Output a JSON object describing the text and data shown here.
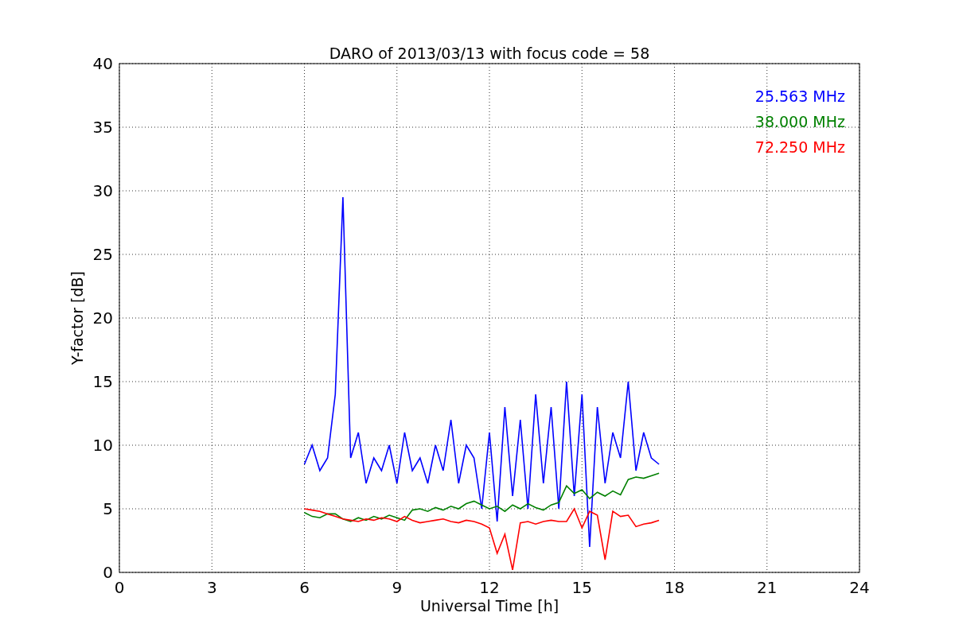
{
  "chart_data": {
    "type": "line",
    "title": "DARO of 2013/03/13 with focus code = 58",
    "xlabel": "Universal Time [h]",
    "ylabel": "Y-factor [dB]",
    "x": [
      6,
      6.25,
      6.5,
      6.75,
      7,
      7.25,
      7.5,
      7.75,
      8,
      8.25,
      8.5,
      8.75,
      9,
      9.25,
      9.5,
      9.75,
      10,
      10.25,
      10.5,
      10.75,
      11,
      11.25,
      11.5,
      11.75,
      12,
      12.25,
      12.5,
      12.75,
      13,
      13.25,
      13.5,
      13.75,
      14,
      14.25,
      14.5,
      14.75,
      15,
      15.25,
      15.5,
      15.75,
      16,
      16.25,
      16.5,
      16.75,
      17,
      17.25,
      17.5
    ],
    "series": [
      {
        "name": "25.563 MHz",
        "color": "#0000ff",
        "values": [
          8.5,
          10,
          8,
          9,
          14,
          29.5,
          9,
          11,
          7,
          9,
          8,
          10,
          7,
          11,
          8,
          9,
          7,
          10,
          8,
          12,
          7,
          10,
          9,
          5,
          11,
          4,
          13,
          6,
          12,
          5,
          14,
          7,
          13,
          5,
          15,
          6,
          14,
          2,
          13,
          7,
          11,
          9,
          15,
          8,
          11,
          9,
          8.5
        ]
      },
      {
        "name": "38.000 MHz",
        "color": "#008000",
        "values": [
          4.7,
          4.4,
          4.3,
          4.6,
          4.6,
          4.2,
          4.0,
          4.3,
          4.1,
          4.4,
          4.2,
          4.5,
          4.3,
          4.1,
          4.9,
          5.0,
          4.8,
          5.1,
          4.9,
          5.2,
          5.0,
          5.4,
          5.6,
          5.3,
          5.0,
          5.2,
          4.8,
          5.3,
          5.0,
          5.4,
          5.1,
          4.9,
          5.3,
          5.5,
          6.8,
          6.2,
          6.5,
          5.8,
          6.3,
          6.0,
          6.4,
          6.1,
          7.3,
          7.5,
          7.4,
          7.6,
          7.8
        ]
      },
      {
        "name": "72.250 MHz",
        "color": "#ff0000",
        "values": [
          5.0,
          4.9,
          4.8,
          4.6,
          4.4,
          4.2,
          4.1,
          4.0,
          4.2,
          4.1,
          4.3,
          4.2,
          4.0,
          4.4,
          4.1,
          3.9,
          4.0,
          4.1,
          4.2,
          4.0,
          3.9,
          4.1,
          4.0,
          3.8,
          3.5,
          1.5,
          3.0,
          0.2,
          3.9,
          4.0,
          3.8,
          4.0,
          4.1,
          4.0,
          4.0,
          5.0,
          3.5,
          4.8,
          4.5,
          1.0,
          4.8,
          4.4,
          4.5,
          3.6,
          3.8,
          3.9,
          4.1
        ]
      }
    ],
    "xlim": [
      0,
      24
    ],
    "ylim": [
      0,
      40
    ],
    "xticks": [
      0,
      3,
      6,
      9,
      12,
      15,
      18,
      21,
      24
    ],
    "yticks": [
      0,
      5,
      10,
      15,
      20,
      25,
      30,
      35,
      40
    ],
    "grid": true
  }
}
